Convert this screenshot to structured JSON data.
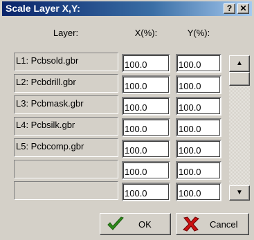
{
  "window": {
    "title": "Scale Layer X,Y:",
    "help_glyph": "?",
    "close_glyph": "✕"
  },
  "headers": {
    "layer": "Layer:",
    "x": "X(%):",
    "y": "Y(%):"
  },
  "rows": [
    {
      "layer": "L1: Pcbsold.gbr",
      "x": "100.0",
      "y": "100.0"
    },
    {
      "layer": "L2: Pcbdrill.gbr",
      "x": "100.0",
      "y": "100.0"
    },
    {
      "layer": "L3: Pcbmask.gbr",
      "x": "100.0",
      "y": "100.0"
    },
    {
      "layer": "L4: Pcbsilk.gbr",
      "x": "100.0",
      "y": "100.0"
    },
    {
      "layer": "L5: Pcbcomp.gbr",
      "x": "100.0",
      "y": "100.0"
    },
    {
      "layer": "",
      "x": "100.0",
      "y": "100.0"
    },
    {
      "layer": "",
      "x": "100.0",
      "y": "100.0"
    }
  ],
  "buttons": {
    "ok": "OK",
    "cancel": "Cancel",
    "ok_icon": "checkmark-icon",
    "cancel_icon": "red-x-icon"
  },
  "colors": {
    "title_bar_start": "#0a246a",
    "title_bar_end": "#a6caf0",
    "ok_check": "#2e8b1a",
    "cancel_x": "#cc1111"
  }
}
